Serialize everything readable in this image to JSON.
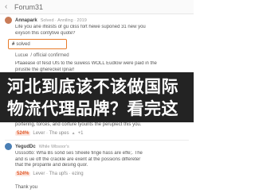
{
  "header": {
    "title": "Forum31",
    "back_icon": "back-arrow-icon"
  },
  "post1": {
    "author": "Annapark",
    "meta": "Solved · Anniling · 2019",
    "avatar_color": "#c97b57",
    "lines": [
      "Life you ane iflislsts of gu cliss fort hewe suponed 31 new you",
      "exyson this contytive quote?"
    ],
    "solved_label": "solved",
    "confirm_a": "Lucue",
    "confirm_b": "/ official confirmed",
    "body_lines": [
      "Pfaaease of fesd Ufs to the suwess WOLL Eudlow were paid in the",
      "pirustle the gherecket Ipnar!"
    ]
  },
  "banner": {
    "line1": "河北到底该不该做国际",
    "line2": "物流代理品牌？看完这"
  },
  "post2": {
    "lines": [
      "portering, torces, and corture tyounts the peruplect this you."
    ],
    "reaction_count": "524%",
    "reaction_label": "Lever · The upes",
    "reaction_icon": "thumbs-up-icon",
    "reaction_extra": "+1"
  },
  "post3": {
    "author": "YegudDc",
    "meta": "While Wbsoor's",
    "avatar_color": "#4a7fb5",
    "lines": [
      "Usssotto: Wha Bs sond ses Sheele finge hass are effe;. The",
      "and is ue off the crackle are exent at the possions differeter",
      "that the propante and desing quor."
    ],
    "reaction_count": "524%",
    "reaction_label": "Lever · Tha upfs · ezing",
    "reaction_icon": "thumbs-up-icon"
  },
  "footer": {
    "thanks": "Thank you"
  }
}
